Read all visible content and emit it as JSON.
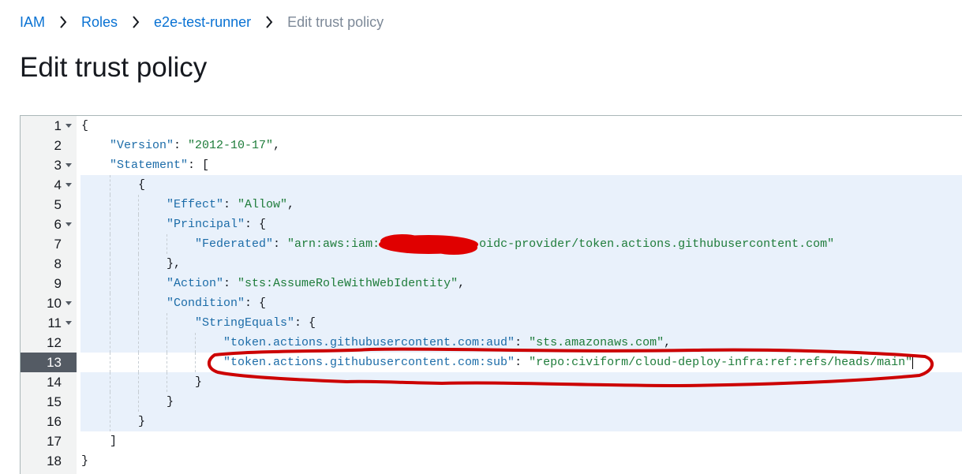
{
  "breadcrumb": {
    "items": [
      "IAM",
      "Roles",
      "e2e-test-runner"
    ],
    "current": "Edit trust policy"
  },
  "page_title": "Edit trust policy",
  "colors": {
    "link": "#0972d3",
    "key": "#1c6ca8",
    "string": "#1e7c3a",
    "highlight": "#e9f1fb",
    "gutter": "#f2f3f3",
    "active_gutter": "#545b64",
    "annotation": "#d00000"
  },
  "editor": {
    "active_line": 13,
    "lines": [
      {
        "n": "1",
        "t": "{"
      },
      {
        "n": "2",
        "k": "\"Version\"",
        "s": "\"2012-10-17\"",
        "e": ","
      },
      {
        "n": "3",
        "k": "\"Statement\"",
        "e": ": ["
      },
      {
        "n": "4",
        "t": "{"
      },
      {
        "n": "5",
        "k": "\"Effect\"",
        "s": "\"Allow\"",
        "e": ","
      },
      {
        "n": "6",
        "k": "\"Principal\"",
        "e": ": {"
      },
      {
        "n": "7",
        "k": "\"Federated\"",
        "s": "\"arn:aws:iam:",
        "s2": "oidc-provider/token.actions.githubusercontent.com\""
      },
      {
        "n": "8",
        "t": "},"
      },
      {
        "n": "9",
        "k": "\"Action\"",
        "s": "\"sts:AssumeRoleWithWebIdentity\"",
        "e": ","
      },
      {
        "n": "10",
        "k": "\"Condition\"",
        "e": ": {"
      },
      {
        "n": "11",
        "k": "\"StringEquals\"",
        "e": ": {"
      },
      {
        "n": "12",
        "k": "\"token.actions.githubusercontent.com:aud\"",
        "s": "\"sts.amazonaws.com\"",
        "e": ","
      },
      {
        "n": "13",
        "k": "\"token.actions.githubusercontent.com:sub\"",
        "s": "\"repo:civiform/cloud-deploy-infra:ref:refs/heads/main\""
      },
      {
        "n": "14",
        "t": "}"
      },
      {
        "n": "15",
        "t": "}"
      },
      {
        "n": "16",
        "t": "}"
      },
      {
        "n": "17",
        "t": "]"
      },
      {
        "n": "18",
        "t": "}"
      }
    ]
  }
}
